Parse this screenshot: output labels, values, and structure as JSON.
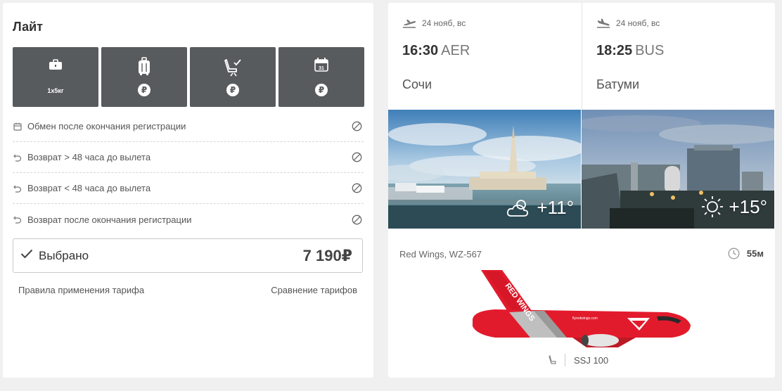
{
  "tariff": {
    "title": "Лайт",
    "options": [
      {
        "icon": "briefcase-icon",
        "label": "1x5кг"
      },
      {
        "icon": "suitcase-icon",
        "label": "₽"
      },
      {
        "icon": "seat-selection-icon",
        "label": "₽"
      },
      {
        "icon": "calendar-icon",
        "label": "₽"
      }
    ],
    "rules": [
      {
        "icon": "calendar-small-icon",
        "label": "Обмен после окончания регистрации",
        "status_icon": "not-allowed-icon"
      },
      {
        "icon": "return-arrow-icon",
        "label": "Возврат > 48 часа до вылета",
        "status_icon": "not-allowed-icon"
      },
      {
        "icon": "return-arrow-icon",
        "label": "Возврат < 48 часа до вылета",
        "status_icon": "not-allowed-icon"
      },
      {
        "icon": "return-arrow-icon",
        "label": "Возврат после окончания регистрации",
        "status_icon": "not-allowed-icon"
      }
    ],
    "selected_label": "Выбрано",
    "price": "7 190₽",
    "rules_link": "Правила применения тарифа",
    "compare_link": "Сравнение тарифов"
  },
  "flight": {
    "departure": {
      "date": "24 нояб, вс",
      "time": "16:30",
      "code": "AER",
      "city": "Сочи",
      "temperature": "+11°",
      "weather_icon": "partly-cloudy-icon"
    },
    "arrival": {
      "date": "24 нояб, вс",
      "time": "18:25",
      "code": "BUS",
      "city": "Батуми",
      "temperature": "+15°",
      "weather_icon": "sun-icon"
    },
    "carrier": "Red Wings, WZ-567",
    "duration": "55м",
    "aircraft": "SSJ 100",
    "livery_text": "RED WINGS",
    "livery_small_text": "flyredwings.com"
  },
  "colors": {
    "background": "#f0f0f0",
    "option_tile": "#585b5e",
    "brand_red": "#e21b2c"
  }
}
